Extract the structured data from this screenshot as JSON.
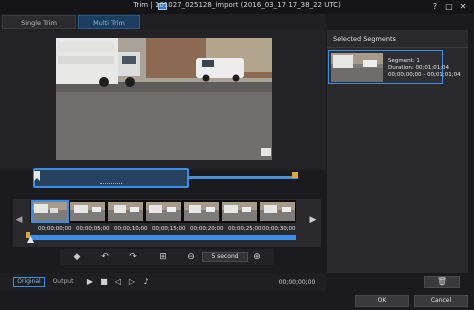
{
  "window": {
    "title": "Trim | 101027_025128_import (2016_03_17 17_38_22 UTC)",
    "help": "?",
    "maximize": "□",
    "close": "✕"
  },
  "tabs": [
    {
      "label": "Single Trim",
      "active": false
    },
    {
      "label": "Multi Trim",
      "active": true
    }
  ],
  "filmstrip": {
    "timecodes": [
      "00;00;00;00",
      "00;00;05;00",
      "00;00;10;00",
      "00;00;15;00",
      "00;00;20;00",
      "00;00;25;00",
      "00;00;30;00"
    ],
    "left_arrow": "◀",
    "right_arrow": "▶"
  },
  "toolbar": {
    "zoom_value": "5 second"
  },
  "playback": {
    "original_label": "Original",
    "output_label": "Output",
    "time": "00;00;00;00"
  },
  "segments": {
    "header": "Selected Segments",
    "items": [
      {
        "segment": "Segment: 1",
        "duration": "Duration: 00;01;01;04",
        "range": "00;00;00;00 - 00;01;01;04"
      }
    ]
  },
  "footer": {
    "ok": "OK",
    "cancel": "Cancel"
  },
  "colors": {
    "accent": "#3a8ee6",
    "marker": "#d8a63a",
    "background": "#1b1b1d"
  }
}
